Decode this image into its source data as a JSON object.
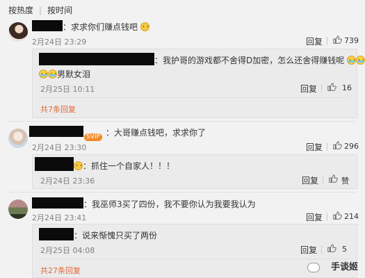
{
  "sort": {
    "hot": "按热度",
    "time": "按时间"
  },
  "comments": [
    {
      "text": "：求求你们赚点钱吧",
      "time": "2月24日 23:29",
      "reply_label": "回复",
      "likes": "739",
      "reply": {
        "text": "：我护哥的游戏都不舍得D加密，怎么还舍得赚钱呢",
        "text2": "男默女泪",
        "time": "2月25日 10:11",
        "reply_label": "回复",
        "likes": "16"
      },
      "more": "共7条回复"
    },
    {
      "badge": "SVIP",
      "text": "：大哥赚点钱吧，求求你了",
      "time": "2月24日 23:30",
      "reply_label": "回复",
      "likes": "296",
      "reply": {
        "text": "：抓住一个自家人！！！",
        "time": "2月24日 23:36",
        "reply_label": "回复",
        "likes": "赞"
      }
    },
    {
      "text": "：我巫师3买了四份，我不要你认为我要我认为",
      "time": "2月24日 23:41",
      "reply_label": "回复",
      "likes": "214",
      "reply": {
        "text": "：说来惭愧只买了两份",
        "time": "2月25日 04:08",
        "reply_label": "回复",
        "likes": "5"
      },
      "more": "共27条回复"
    }
  ],
  "watermark": "手谈姬",
  "colors": {
    "accent": "#e3683a",
    "background": "#f2f2f2",
    "redaction": "#0b0b0b"
  },
  "icons": [
    "thumbs-up-icon",
    "emoji-icon",
    "watermark-logo-icon"
  ]
}
